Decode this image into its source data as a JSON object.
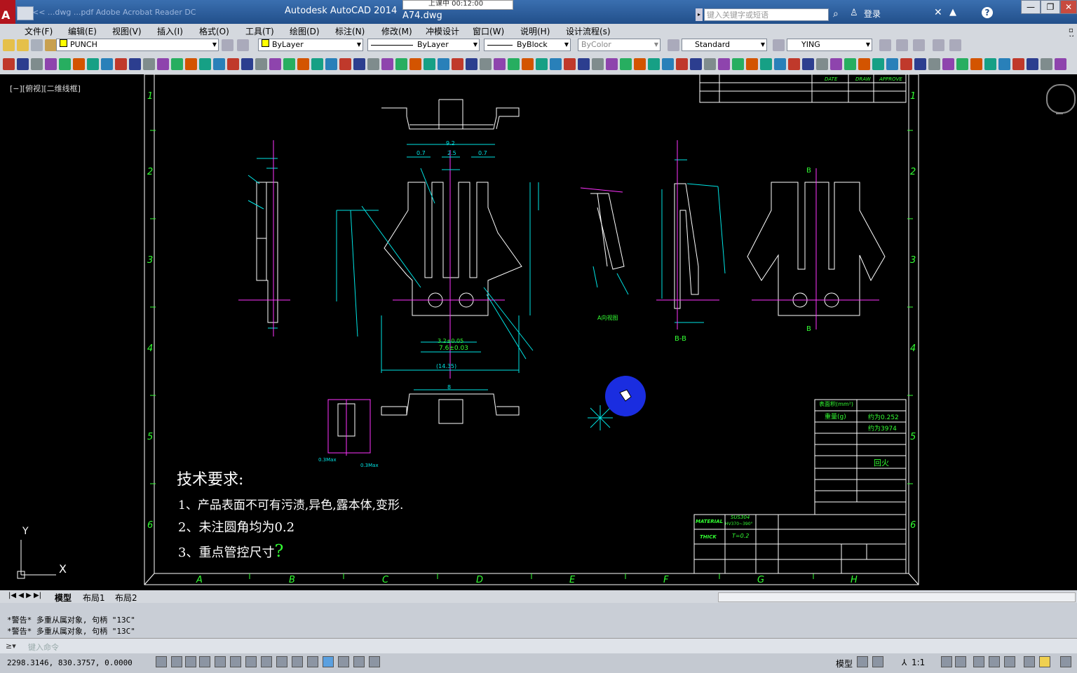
{
  "title": {
    "app": "Autodesk AutoCAD 2014",
    "file": "A74.dwg",
    "popup": "上课中 00:12:00",
    "file_tabs": "<<  ...dwg  ...pdf  Adobe Acrobat Reader DC",
    "search_placeholder": "键入关键字或短语",
    "login": "登录"
  },
  "menu": [
    "文件(F)",
    "编辑(E)",
    "视图(V)",
    "插入(I)",
    "格式(O)",
    "工具(T)",
    "绘图(D)",
    "标注(N)",
    "修改(M)",
    "冲模设计",
    "窗口(W)",
    "说明(H)",
    "设计流程(s)"
  ],
  "toolbar": {
    "layer": "PUNCH",
    "color": "ByLayer",
    "linetype": "ByLayer",
    "lineweight": "ByBlock",
    "plotstyle": "ByColor",
    "textstyle": "Standard",
    "dimstyle": "YING"
  },
  "viewport_label": "[−][俯视][二维线框]",
  "drawing": {
    "tech_title": "技术要求:",
    "tech_items": [
      "1、产品表面不可有污渍,异色,露本体,变形.",
      "2、未注圆角均为0.2",
      "3、重点管控尺寸"
    ],
    "check_mark": "?",
    "material_label": "MATERIAL",
    "material_value": "SUS304",
    "material_hardness": "HV370~390°",
    "thick_label": "THICK",
    "thick_value": "T=0.2",
    "weight_label": "重量(g)",
    "weight_value": "约为0.252",
    "count_value": "约为3974",
    "heat_treat": "回火",
    "area_label": "表面积(mm²)",
    "col_labels": [
      "A",
      "B",
      "C",
      "D",
      "E",
      "F",
      "G",
      "H"
    ],
    "row_labels": [
      "1",
      "2",
      "3",
      "4",
      "5",
      "6"
    ],
    "section_label": "B-B",
    "view_a_label": "A向视图",
    "dim_92": "9.2",
    "dim_07a": "0.7",
    "dim_25": "2.5",
    "dim_07b": "0.7",
    "dim_8": "8",
    "dim_1435": "(14.35)",
    "dim_32": "3.2±0.05",
    "dim_76": "7.6±0.03",
    "label_b_top": "B",
    "label_b_bottom": "B",
    "hdr_date": "DATE",
    "hdr_draw": "DRAW",
    "hdr_approve": "APPROVE",
    "dim_03max_a": "0.3Max",
    "dim_03max_b": "0.3Max",
    "ucs_x": "X",
    "ucs_y": "Y"
  },
  "layout_tabs": [
    "模型",
    "布局1",
    "布局2"
  ],
  "command": {
    "history": [
      "*警告* 多重从属对象, 句柄 \"13C\"",
      "*警告* 多重从属对象, 句柄 \"13C\""
    ],
    "placeholder": "键入命令"
  },
  "status": {
    "coords": "2298.3146, 830.3757, 0.0000",
    "model": "模型",
    "scale": "1:1"
  },
  "colors": {
    "title_bar": "#2b5b99",
    "chrome": "#d4d8de",
    "canvas": "#000000",
    "border": "#ffffff",
    "dimension": "#00e5e5",
    "annotation": "#33ff33",
    "centerline": "#ff33ff",
    "cursor": "#1a2de0"
  }
}
